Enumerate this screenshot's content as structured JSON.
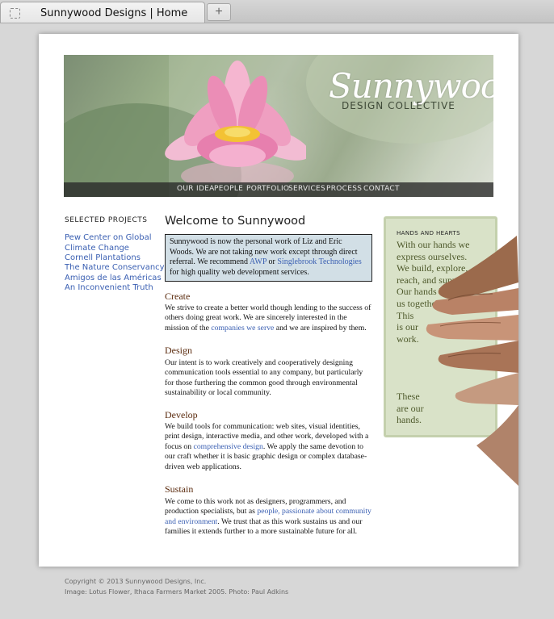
{
  "browser": {
    "tab_title": "Sunnywood Designs | Home",
    "new_tab_glyph": "+"
  },
  "banner": {
    "logo_script": "Sunnywood",
    "logo_sub": "DESIGN  COLLECTIVE",
    "nav": [
      "OUR IDEA",
      "PEOPLE",
      "PORTFOLIO",
      "SERVICES",
      "PROCESS",
      "CONTACT"
    ]
  },
  "sidebar": {
    "title": "SELECTED PROJECTS",
    "projects": [
      "Pew Center on Global",
      "Climate Change",
      "Cornell Plantations",
      "The Nature Conservancy",
      "Amigos de las Américas",
      "An Inconvenient Truth"
    ]
  },
  "main": {
    "heading": "Welcome to Sunnywood",
    "notice": {
      "line1": "Sunnywood is now the personal work of Liz and Eric Woods. We are not taking new work except through direct referral. We recommend ",
      "link1": "AWP",
      "mid": " or ",
      "link2": "Singlebrook Technologies",
      "end": " for high quality web development services."
    },
    "create": {
      "title": "Create",
      "text1": "We strive to create a better world though lending to the success of others doing great work. We are sincerely interested in the mission of the ",
      "link": "companies we serve",
      "text2": " and we are inspired by them."
    },
    "design": {
      "title": "Design",
      "text": "Our intent is to work creatively and cooperatively designing communication tools essential to any company, but particularly for those furthering the common good through environmental sustainability or local community."
    },
    "develop": {
      "title": "Develop",
      "text1": "We build tools for communication: web sites, visual identities, print design, interactive media, and other work, developed with a focus on ",
      "link": "comprehensive design",
      "text2": ". We apply the same devotion to our craft whether it is basic graphic design or complex database-driven web applications."
    },
    "sustain": {
      "title": "Sustain",
      "text1": "We come to this work not as designers, programmers, and production specialists, but as ",
      "link": "people, passionate about community and environment",
      "text2": ". We trust that as this work sustains us and our families it extends further to a more sustainable future for all."
    }
  },
  "hands": {
    "title": "HANDS AND HEARTS",
    "lines": [
      "With our hands we",
      "express ourselves.",
      "We build, explore,",
      "reach, and support.",
      "Our hands bring",
      "us together.",
      "This",
      "is our",
      "work."
    ],
    "lines2": [
      "These",
      "are our",
      "hands."
    ]
  },
  "footer": {
    "copyright": "Copyright © 2013 Sunnywood Designs, Inc.",
    "credit": "Image: Lotus Flower, Ithaca Farmers Market 2005. Photo: Paul Adkins"
  },
  "colors": {
    "link": "#3a5fb2",
    "section_title": "#5a2a0d",
    "notice_bg": "#d2dfe6",
    "hands_bg": "#d9e2c8"
  }
}
